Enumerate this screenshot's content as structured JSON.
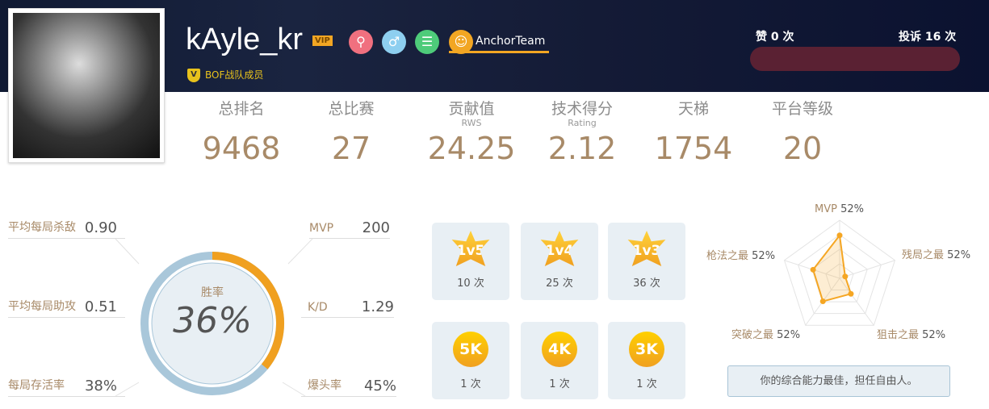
{
  "profile": {
    "name": "kAyle_kr",
    "vip_badge": "VIP",
    "team": "AnchorTeam",
    "tag": "BOF战队成员",
    "tag_icon": "V"
  },
  "feedback": {
    "likes": "赞 0 次",
    "complaints": "投诉 16 次",
    "bar_color": "#5a2133"
  },
  "stats": [
    {
      "label": "总排名",
      "sub": "",
      "value": "9468"
    },
    {
      "label": "总比赛",
      "sub": "",
      "value": "27"
    },
    {
      "label": "贡献值",
      "sub": "RWS",
      "value": "24.25"
    },
    {
      "label": "技术得分",
      "sub": "Rating",
      "value": "2.12"
    },
    {
      "label": "天梯",
      "sub": "",
      "value": "1754"
    },
    {
      "label": "平台等级",
      "sub": "",
      "value": "20"
    }
  ],
  "left_metrics": [
    {
      "label": "平均每局杀敌",
      "value": "0.90"
    },
    {
      "label": "平均每局助攻",
      "value": "0.51"
    },
    {
      "label": "每局存活率",
      "value": "38%"
    }
  ],
  "right_metrics": [
    {
      "label": "MVP",
      "value": "200"
    },
    {
      "label": "K/D",
      "value": "1.29"
    },
    {
      "label": "爆头率",
      "value": "45%"
    }
  ],
  "winrate": {
    "label": "胜率",
    "value": "36%",
    "fraction": 0.36,
    "accent": "#f0a020",
    "track": "#a9c7da"
  },
  "medals": [
    {
      "icon": "1v5",
      "count": "10 次"
    },
    {
      "icon": "1v4",
      "count": "25 次"
    },
    {
      "icon": "1v3",
      "count": "36 次"
    },
    {
      "icon": "5K",
      "count": "1 次"
    },
    {
      "icon": "4K",
      "count": "1 次"
    },
    {
      "icon": "3K",
      "count": "1 次"
    }
  ],
  "radar": {
    "axes": [
      {
        "label": "MVP",
        "value": "52%",
        "level": 0.74
      },
      {
        "label": "残局之最",
        "value": "52%",
        "level": 0.1
      },
      {
        "label": "狙击之最",
        "value": "52%",
        "level": 0.33
      },
      {
        "label": "突破之最",
        "value": "52%",
        "level": 0.49
      },
      {
        "label": "枪法之最",
        "value": "52%",
        "level": 0.48
      }
    ],
    "color": "#f5a623"
  },
  "summary": "你的综合能力最佳，担任自由人。"
}
